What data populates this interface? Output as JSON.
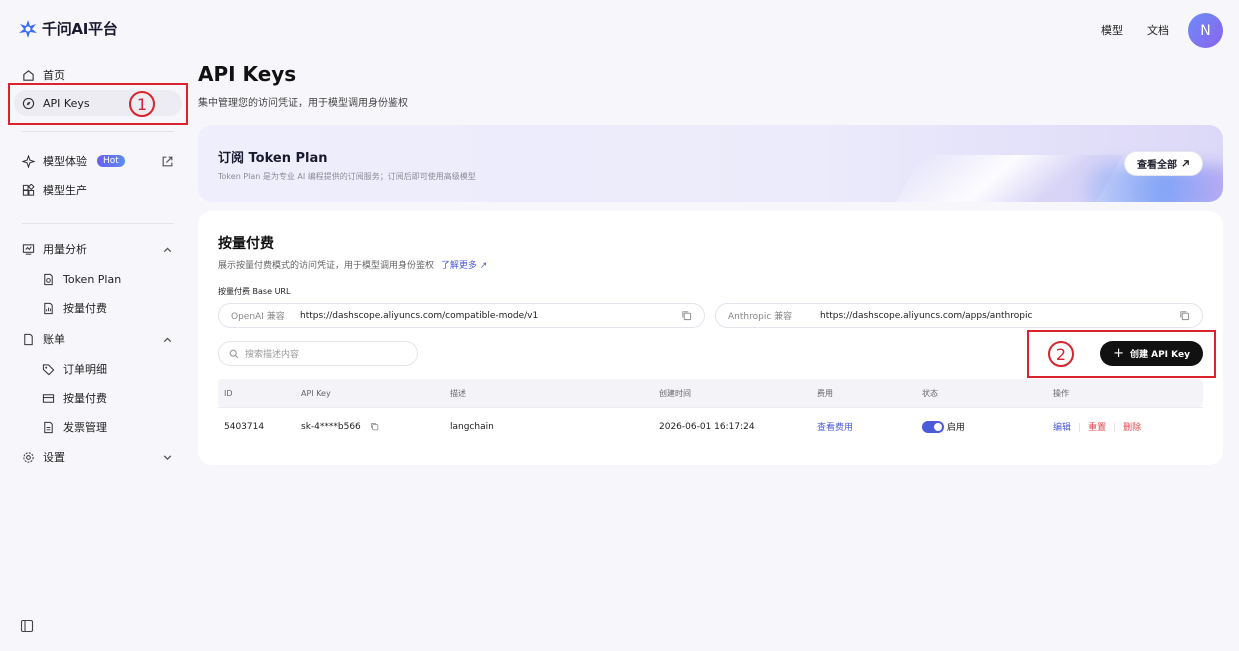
{
  "brand": {
    "name": "千问AI平台"
  },
  "top_links": [
    "模型",
    "文档"
  ],
  "user": {
    "avatar_initial": "N"
  },
  "sidebar": {
    "items": [
      {
        "label": "首页",
        "icon": "home-icon"
      },
      {
        "label": "API Keys",
        "icon": "compass-icon",
        "active": true
      },
      {
        "label": "模型体验",
        "icon": "sparkle-icon",
        "badge": "Hot"
      },
      {
        "label": "模型生产",
        "icon": "blocks-icon"
      },
      {
        "label": "用量分析",
        "icon": "monitor-chart-icon"
      },
      {
        "label": "Token Plan",
        "icon": "doc-icon"
      },
      {
        "label": "按量付费",
        "icon": "doc-chart-icon"
      },
      {
        "label": "账单",
        "icon": "file-icon"
      },
      {
        "label": "订单明细",
        "icon": "tag-icon"
      },
      {
        "label": "按量付费",
        "icon": "card-icon"
      },
      {
        "label": "发票管理",
        "icon": "invoice-icon"
      },
      {
        "label": "设置",
        "icon": "gear-icon"
      }
    ]
  },
  "annotations": [
    "1",
    "2"
  ],
  "page": {
    "title": "API Keys",
    "subtitle": "集中管理您的访问凭证，用于模型调用身份鉴权"
  },
  "banner": {
    "title": "订阅 Token Plan",
    "subtitle": "Token Plan 是为专业 AI 编程提供的订阅服务；订阅后即可使用高级模型",
    "button": "查看全部"
  },
  "payg": {
    "title": "按量付费",
    "subtitle": "展示按量付费模式的访问凭证，用于模型调用身份鉴权",
    "learn_more": "了解更多",
    "base_url_label": "按量付费 Base URL",
    "openai_tag": "OpenAI 兼容",
    "openai_url": "https://dashscope.aliyuncs.com/compatible-mode/v1",
    "anthropic_tag": "Anthropic 兼容",
    "anthropic_url": "https://dashscope.aliyuncs.com/apps/anthropic",
    "search_placeholder": "搜索描述内容",
    "create_button": "创建 API Key"
  },
  "table": {
    "headers": [
      "ID",
      "API Key",
      "描述",
      "创建时间",
      "费用",
      "状态",
      "操作"
    ],
    "rows": [
      {
        "id": "5403714",
        "key": "sk-4****b566",
        "desc": "langchain",
        "created": "2026-06-01 16:17:24",
        "cost": "查看费用",
        "status": "启用",
        "ops": [
          "编辑",
          "重置",
          "删除"
        ]
      }
    ]
  }
}
